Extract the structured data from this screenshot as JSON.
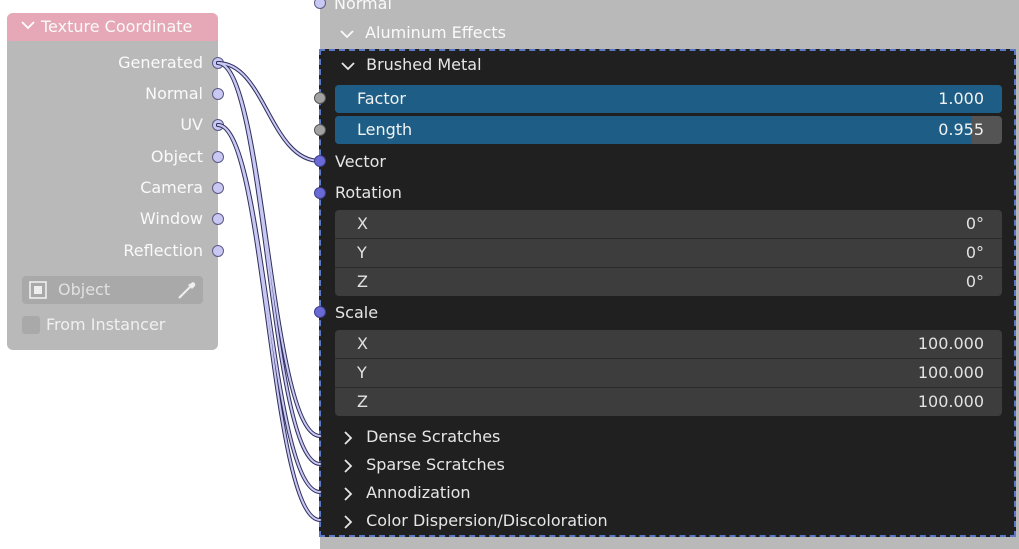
{
  "texture_coordinate": {
    "title": "Texture Coordinate",
    "outputs": [
      "Generated",
      "Normal",
      "UV",
      "Object",
      "Camera",
      "Window",
      "Reflection"
    ],
    "object_field": {
      "placeholder": "Object"
    },
    "from_instancer": {
      "label": "From Instancer",
      "checked": false
    }
  },
  "group": {
    "normal_label": "Normal",
    "aluminum_effects": "Aluminum Effects",
    "brushed_metal": {
      "title": "Brushed Metal",
      "factor": {
        "label": "Factor",
        "value": "1.000",
        "fill": 1.0
      },
      "length": {
        "label": "Length",
        "value": "0.955",
        "fill": 0.955
      },
      "vector_label": "Vector",
      "rotation": {
        "label": "Rotation",
        "x": {
          "label": "X",
          "value": "0°"
        },
        "y": {
          "label": "Y",
          "value": "0°"
        },
        "z": {
          "label": "Z",
          "value": "0°"
        }
      },
      "scale": {
        "label": "Scale",
        "x": {
          "label": "X",
          "value": "100.000"
        },
        "y": {
          "label": "Y",
          "value": "100.000"
        },
        "z": {
          "label": "Z",
          "value": "100.000"
        }
      }
    },
    "collapsed_panels": [
      "Dense Scratches",
      "Sparse Scratches",
      "Annodization",
      "Color Dispersion/Discoloration"
    ]
  },
  "colors": {
    "header_pink": "#e6a8b6",
    "node_bg": "#b9b9b9",
    "panel_bg": "#202020",
    "slider_fill": "#1e5e86",
    "selection_border": "#5b78c6",
    "socket_vector": "#6a6ad6",
    "socket_lavender": "#c9c8f2"
  }
}
